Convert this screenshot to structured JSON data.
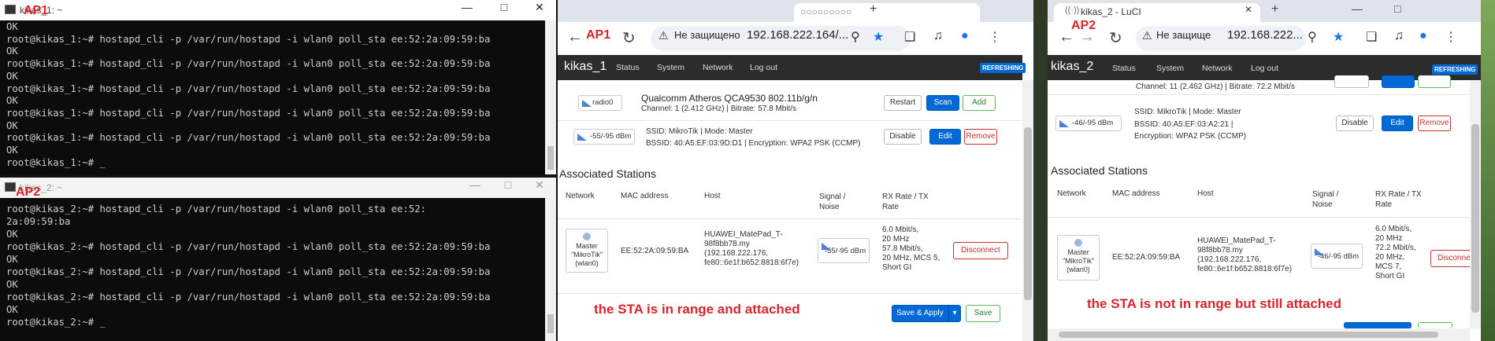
{
  "terminal1": {
    "title": "kikas_1: ~",
    "label": "AP1",
    "lines": [
      "OK",
      "root@kikas_1:~# hostapd_cli -p /var/run/hostapd -i wlan0 poll_sta ee:52:2a:09:59:ba",
      "OK",
      "root@kikas_1:~# hostapd_cli -p /var/run/hostapd -i wlan0 poll_sta ee:52:2a:09:59:ba",
      "OK",
      "root@kikas_1:~# hostapd_cli -p /var/run/hostapd -i wlan0 poll_sta ee:52:2a:09:59:ba",
      "OK",
      "root@kikas_1:~# hostapd_cli -p /var/run/hostapd -i wlan0 poll_sta ee:52:2a:09:59:ba",
      "OK",
      "root@kikas_1:~# hostapd_cli -p /var/run/hostapd -i wlan0 poll_sta ee:52:2a:09:59:ba",
      "OK",
      "root@kikas_1:~# _"
    ]
  },
  "terminal2": {
    "title": "kikas_2: ~",
    "label": "AP2",
    "lines": [
      "root@kikas_2:~# hostapd_cli -p /var/run/hostapd -i wlan0 poll_sta ee:52:",
      "2a:09:59:ba",
      "OK",
      "root@kikas_2:~# hostapd_cli -p /var/run/hostapd -i wlan0 poll_sta ee:52:2a:09:59:ba",
      "OK",
      "root@kikas_2:~# hostapd_cli -p /var/run/hostapd -i wlan0 poll_sta ee:52:2a:09:59:ba",
      "OK",
      "root@kikas_2:~# hostapd_cli -p /var/run/hostapd -i wlan0 poll_sta ee:52:2a:09:59:ba",
      "OK",
      "root@kikas_2:~# _"
    ]
  },
  "browser1": {
    "label": "AP1",
    "security": "Не защищено",
    "url": "192.168.222.164/...",
    "brand": "kikas_1",
    "menu": [
      "Status",
      "System",
      "Network",
      "Log out"
    ],
    "refreshing": "REFRESHING",
    "radio": {
      "name": "radio0",
      "device": "Qualcomm Atheros QCA9530 802.11b/g/n",
      "info": "Channel: 1 (2.412 GHz) | Bitrate: 57.8 Mbit/s",
      "restart": "Restart",
      "scan": "Scan",
      "add": "Add"
    },
    "wifi": {
      "signal": "-55/-95 dBm",
      "line1": "SSID: MikroTik | Mode: Master",
      "line2": "BSSID: 40:A5:EF:03:9D:D1 | Encryption: WPA2 PSK (CCMP)",
      "disable": "Disable",
      "edit": "Edit",
      "remove": "Remove"
    },
    "assoc_title": "Associated Stations",
    "headers": [
      "Network",
      "MAC address",
      "Host",
      "Signal / Noise",
      "RX Rate / TX Rate"
    ],
    "station": {
      "network": [
        "Master",
        "\"MikroTik\"",
        "(wlan0)"
      ],
      "mac": "EE:52:2A:09:59:BA",
      "host": [
        "HUAWEI_MatePad_T-",
        "98f8bb78.my",
        "(192.168.222.176,",
        "fe80::6e1f:b652:8818:6f7e)"
      ],
      "signal": "-55/-95 dBm",
      "rate": [
        "6.0 Mbit/s,",
        "20 MHz",
        "57.8 Mbit/s,",
        "20 MHz, MCS 5,",
        "Short GI"
      ],
      "disconnect": "Disconnect"
    },
    "annotation": "the STA is in range and attached",
    "save_apply": "Save & Apply",
    "save": "Save"
  },
  "browser2": {
    "label": "AP2",
    "tab_title": "kikas_2 - LuCI",
    "security": "Не защище",
    "url": "192.168.222...",
    "brand": "kikas_2",
    "menu": [
      "Status",
      "System",
      "Network",
      "Log out"
    ],
    "refreshing": "REFRESHING",
    "radio_info": "Channel: 11 (2.462 GHz) | Bitrate: 72.2 Mbit/s",
    "wifi": {
      "signal": "-46/-95 dBm",
      "line1": "SSID: MikroTik | Mode: Master",
      "line2": "BSSID: 40:A5:EF:03:A2:21 |",
      "line3": "Encryption: WPA2 PSK (CCMP)",
      "disable": "Disable",
      "edit": "Edit",
      "remove": "Remove"
    },
    "assoc_title": "Associated Stations",
    "headers": [
      "Network",
      "MAC address",
      "Host",
      "Signal / Noise",
      "RX Rate / TX Rate"
    ],
    "station": {
      "network": [
        "Master",
        "\"MikroTik\"",
        "(wlan0)"
      ],
      "mac": "EE:52:2A:09:59:BA",
      "host": [
        "HUAWEI_MatePad_T-",
        "98f8bb78.my",
        "(192.168.222.176,",
        "fe80::6e1f:b652:8818:6f7e)"
      ],
      "signal": "-46/-95 dBm",
      "rate": [
        "6.0 Mbit/s,",
        "20 MHz",
        "72.2 Mbit/s,",
        "20 MHz,",
        "MCS 7,",
        "Short GI"
      ],
      "disconnect": "Disconnect"
    },
    "annotation": "the STA is not in range but still attached"
  }
}
